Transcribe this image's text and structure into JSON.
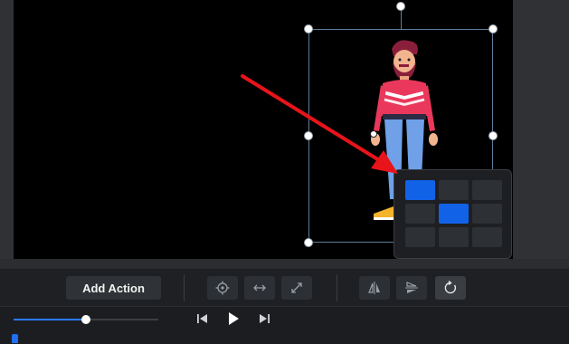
{
  "toolbar": {
    "add_action_label": "Add Action"
  },
  "icons": {
    "target": "target-icon",
    "move_horizontal": "arrows-horizontal-icon",
    "resize": "resize-diagonal-icon",
    "flip_horizontal": "flip-horizontal-icon",
    "flip_vertical": "flip-vertical-icon",
    "rotate": "rotate-icon",
    "skip_back": "skip-back-icon",
    "play": "play-icon",
    "skip_forward": "skip-forward-icon"
  },
  "playback": {
    "volume_level": 0.5
  },
  "position_grid": {
    "rows": 3,
    "cols": 3,
    "active_cells": [
      [
        0,
        0
      ],
      [
        1,
        1
      ]
    ]
  },
  "colors": {
    "accent": "#1262e8",
    "arrow": "#e8141a"
  }
}
